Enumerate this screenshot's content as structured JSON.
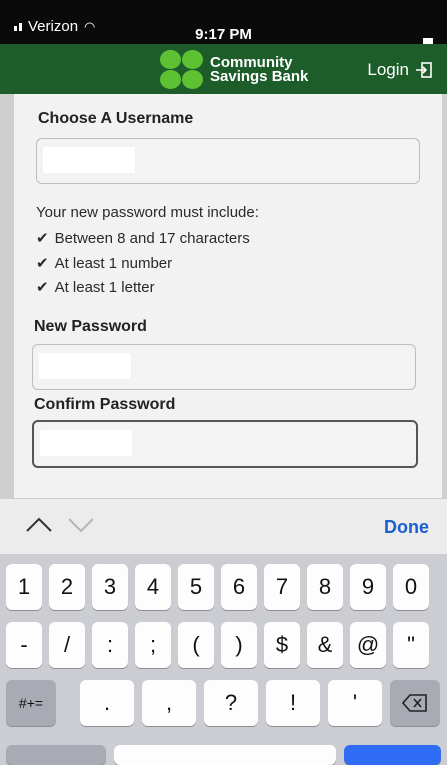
{
  "status": {
    "carrier": "Verizon",
    "time": "9:17 PM"
  },
  "header": {
    "brand_line1": "Community",
    "brand_line2": "Savings Bank",
    "login_label": "Login"
  },
  "form": {
    "username_label": "Choose A Username",
    "password_rules_intro": "Your new password must include:",
    "rules": [
      "Between 8 and 17 characters",
      "At least 1 number",
      "At least 1 letter"
    ],
    "new_password_label": "New Password",
    "confirm_password_label": "Confirm Password"
  },
  "toolbar": {
    "done_label": "Done"
  },
  "keyboard": {
    "row1": [
      "1",
      "2",
      "3",
      "4",
      "5",
      "6",
      "7",
      "8",
      "9",
      "0"
    ],
    "row2": [
      "-",
      "/",
      ":",
      ";",
      "(",
      ")",
      "$",
      "&",
      "@",
      "\""
    ],
    "row3_left": "#+=",
    "row3": [
      ".",
      ",",
      "?",
      "!",
      "'"
    ]
  },
  "colors": {
    "header_bg": "#1d5d2a",
    "clover": "#5dc133",
    "done": "#1a5fd0"
  }
}
